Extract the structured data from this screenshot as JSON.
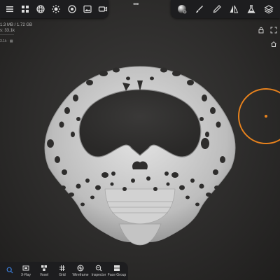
{
  "top_left_toolbar": {
    "icons": [
      "menu-icon",
      "grid-icon",
      "sphere-icon",
      "sun-icon",
      "globe-icon",
      "image-icon",
      "camera-icon"
    ]
  },
  "top_right_toolbar": {
    "icons": [
      "material-sphere-icon",
      "brush-icon",
      "pen-icon",
      "mirror-icon",
      "flask-icon",
      "layers-icon"
    ]
  },
  "stats": {
    "memory": "1.3 MB / 1.72 GB",
    "faces": "s: 33.1k"
  },
  "scene": {
    "info": "3.1k · ▦"
  },
  "bottom_toolbar": {
    "items": [
      {
        "label": "",
        "icon": "search-icon"
      },
      {
        "label": "X-Ray",
        "icon": "xray-icon"
      },
      {
        "label": "Voxel",
        "icon": "voxel-icon"
      },
      {
        "label": "Grid",
        "icon": "grid-icon"
      },
      {
        "label": "Wireframe",
        "icon": "wireframe-icon"
      },
      {
        "label": "Inspector",
        "icon": "inspector-icon"
      },
      {
        "label": "Face Group",
        "icon": "face-group-icon"
      }
    ]
  },
  "colors": {
    "toolbar_bg": "#1d1d1f",
    "gizmo": "#e8821d",
    "model": "#c9c9c9"
  }
}
